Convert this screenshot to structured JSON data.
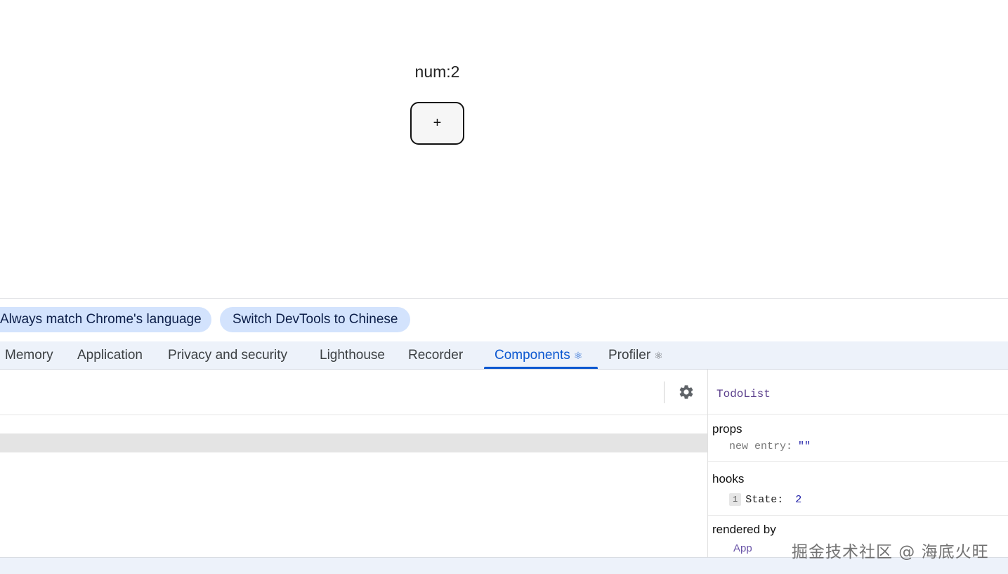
{
  "page": {
    "num_label": "num:2",
    "button_label": "+"
  },
  "language_bar": {
    "match_language": "Always match Chrome's language",
    "switch_language": "Switch DevTools to Chinese"
  },
  "tabs": [
    {
      "label": "Memory",
      "active": false
    },
    {
      "label": "Application",
      "active": false
    },
    {
      "label": "Privacy and security",
      "active": false
    },
    {
      "label": "Lighthouse",
      "active": false
    },
    {
      "label": "Recorder",
      "active": false
    },
    {
      "label": "Components",
      "active": true,
      "icon": "react-icon"
    },
    {
      "label": "Profiler",
      "active": false,
      "icon": "react-icon"
    }
  ],
  "toolbar": {
    "settings_icon": "gear-icon"
  },
  "inspector": {
    "component_name": "TodoList",
    "props_title": "props",
    "props": [
      {
        "key": "new entry",
        "value": "\"\""
      }
    ],
    "hooks_title": "hooks",
    "hooks": [
      {
        "index": "1",
        "key": "State",
        "value": "2"
      }
    ],
    "rendered_by_title": "rendered by",
    "rendered_by": [
      "App"
    ]
  },
  "watermark": "掘金技术社区 @ 海底火旺",
  "colors": {
    "accent": "#0b57d0",
    "pill_bg": "#d3e3fd",
    "tabstrip_bg": "#edf2fa",
    "component_name": "#5b3f8c"
  }
}
